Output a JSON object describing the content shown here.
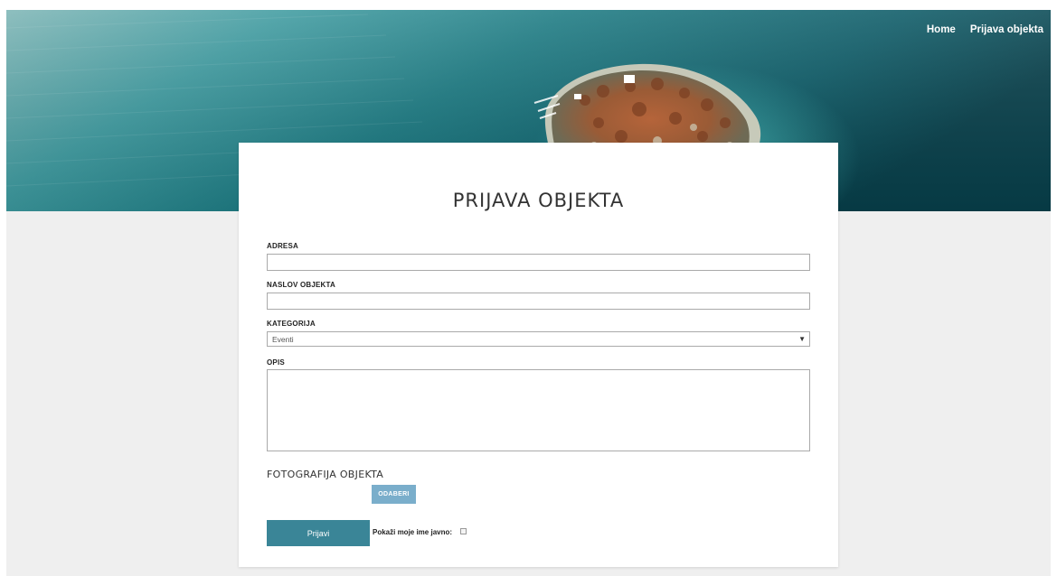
{
  "nav": {
    "items": [
      {
        "label": "Home"
      },
      {
        "label": "Prijava objekta"
      }
    ]
  },
  "form": {
    "title": "PRIJAVA OBJEKTA",
    "adresa": {
      "label": "ADRESA",
      "value": ""
    },
    "naslov": {
      "label": "NASLOV OBJEKTA",
      "value": ""
    },
    "kategorija": {
      "label": "KATEGORIJA",
      "selected": "Eventi"
    },
    "opis": {
      "label": "OPIS",
      "value": ""
    },
    "foto": {
      "label": "FOTOGRAFIJA OBJEKTA",
      "button_label": "ODABERI"
    },
    "submit_label": "Prijavi",
    "public_label": "Pokaži moje ime javno:",
    "public_checked": false
  },
  "colors": {
    "background": "#efefef",
    "submit": "#3a8597",
    "odaberi": "#7aaecb",
    "sea_deep": "#0b5560",
    "sea_light": "#3c9ea0"
  },
  "icons": {
    "select_arrow": "chevron-down-icon"
  }
}
